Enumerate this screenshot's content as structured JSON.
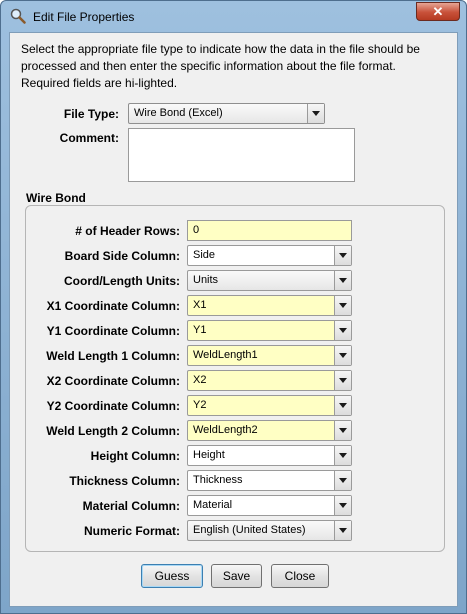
{
  "window": {
    "title": "Edit File Properties",
    "close_glyph": "✕"
  },
  "intro": {
    "lines": [
      "Select the appropriate file type to indicate how the data in the file should be",
      "processed and then enter the specific information about the file format.",
      "Required fields are hi-lighted."
    ]
  },
  "file_type": {
    "label": "File Type:",
    "value": "Wire Bond (Excel)"
  },
  "comment": {
    "label": "Comment:",
    "value": ""
  },
  "group": {
    "title": "Wire Bond",
    "fields": [
      {
        "label": "# of Header Rows:",
        "value": "0",
        "kind": "text",
        "required": true
      },
      {
        "label": "Board Side Column:",
        "value": "Side",
        "kind": "combo",
        "required": false
      },
      {
        "label": "Coord/Length Units:",
        "value": "Units",
        "kind": "dropdown",
        "required": false
      },
      {
        "label": "X1 Coordinate Column:",
        "value": "X1",
        "kind": "combo",
        "required": true
      },
      {
        "label": "Y1 Coordinate Column:",
        "value": "Y1",
        "kind": "combo",
        "required": true
      },
      {
        "label": "Weld Length 1 Column:",
        "value": "WeldLength1",
        "kind": "combo",
        "required": true
      },
      {
        "label": "X2 Coordinate Column:",
        "value": "X2",
        "kind": "combo",
        "required": true
      },
      {
        "label": "Y2 Coordinate Column:",
        "value": "Y2",
        "kind": "combo",
        "required": true
      },
      {
        "label": "Weld Length 2 Column:",
        "value": "WeldLength2",
        "kind": "combo",
        "required": true
      },
      {
        "label": "Height Column:",
        "value": "Height",
        "kind": "combo",
        "required": false
      },
      {
        "label": "Thickness Column:",
        "value": "Thickness",
        "kind": "combo",
        "required": false
      },
      {
        "label": "Material Column:",
        "value": "Material",
        "kind": "combo",
        "required": false
      },
      {
        "label": "Numeric Format:",
        "value": "English (United States)",
        "kind": "dropdown",
        "required": false
      }
    ]
  },
  "buttons": {
    "guess": "Guess",
    "save": "Save",
    "close": "Close"
  },
  "colors": {
    "required_bg": "#ffffc4",
    "title_bar": "#9ec0df",
    "close_button": "#c8513a"
  },
  "icons": {
    "title_icon": "magnifier-icon",
    "dropdown_arrow": "chevron-down-icon"
  }
}
